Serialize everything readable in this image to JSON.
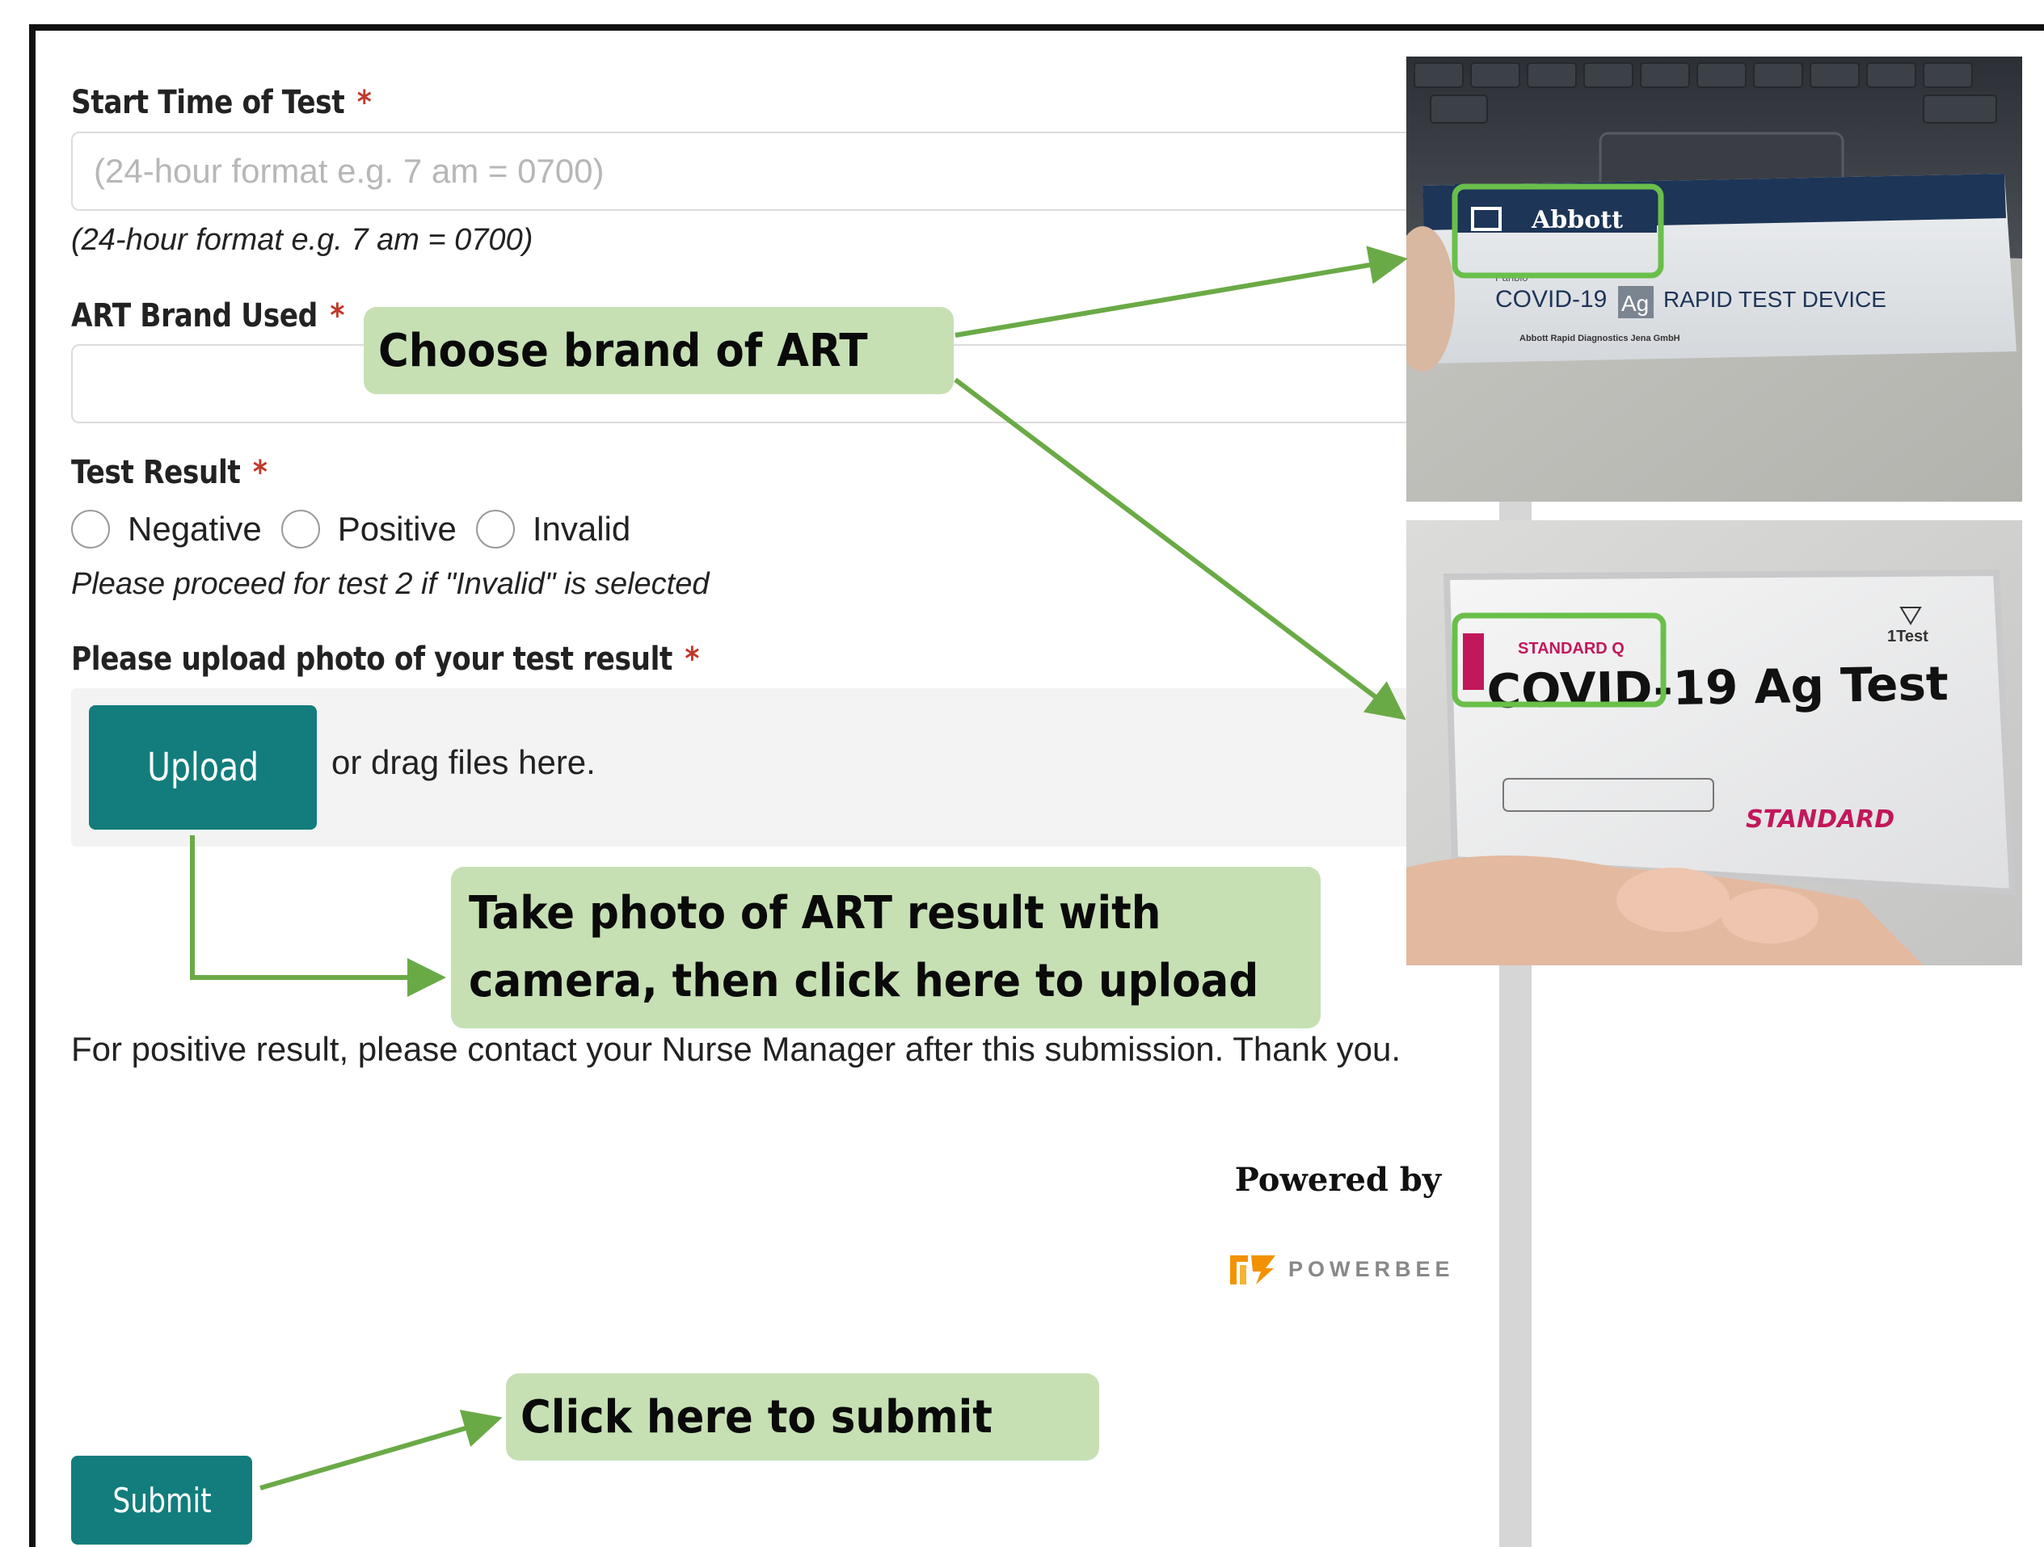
{
  "form": {
    "start_time": {
      "label": "Start Time of Test",
      "required_mark": "*",
      "placeholder": "(24-hour format e.g. 7 am = 0700)",
      "hint": "(24-hour format e.g. 7 am = 0700)",
      "value": ""
    },
    "art_brand": {
      "label": "ART Brand Used",
      "required_mark": "*",
      "value": ""
    },
    "test_result": {
      "label": "Test Result",
      "required_mark": "*",
      "options": [
        "Negative",
        "Positive",
        "Invalid"
      ],
      "hint": "Please proceed for test 2 if \"Invalid\" is selected"
    },
    "upload": {
      "label": "Please upload photo of your test result",
      "required_mark": "*",
      "button_label": "Upload",
      "drag_text": "or drag files here."
    },
    "note": "For positive result, please contact your Nurse Manager after this submission. Thank you.",
    "powered_by": "Powered by",
    "brand_logo_text": "POWERBEE",
    "submit_label": "Submit"
  },
  "callouts": {
    "brand": "Choose brand of ART",
    "photo_line1": "Take photo of ART result with",
    "photo_line2": "camera, then click here to upload",
    "submit": "Click here to submit"
  },
  "photos": {
    "abbott": {
      "brand": "Abbott",
      "small_brand": "Panbio",
      "product": "COVID-19",
      "ag": "Ag",
      "device": "RAPID TEST DEVICE",
      "maker": "Abbott Rapid Diagnostics Jena GmbH"
    },
    "standard": {
      "small_brand": "STANDARD Q",
      "product": "COVID-19 Ag Test",
      "count": "1Test",
      "logo": "STANDARD"
    }
  },
  "colors": {
    "teal": "#127d7c",
    "callout_bg": "#c6e0b4",
    "arrow": "#6aaa46",
    "required": "#c0392b",
    "highlight_box": "#6abf4b"
  }
}
